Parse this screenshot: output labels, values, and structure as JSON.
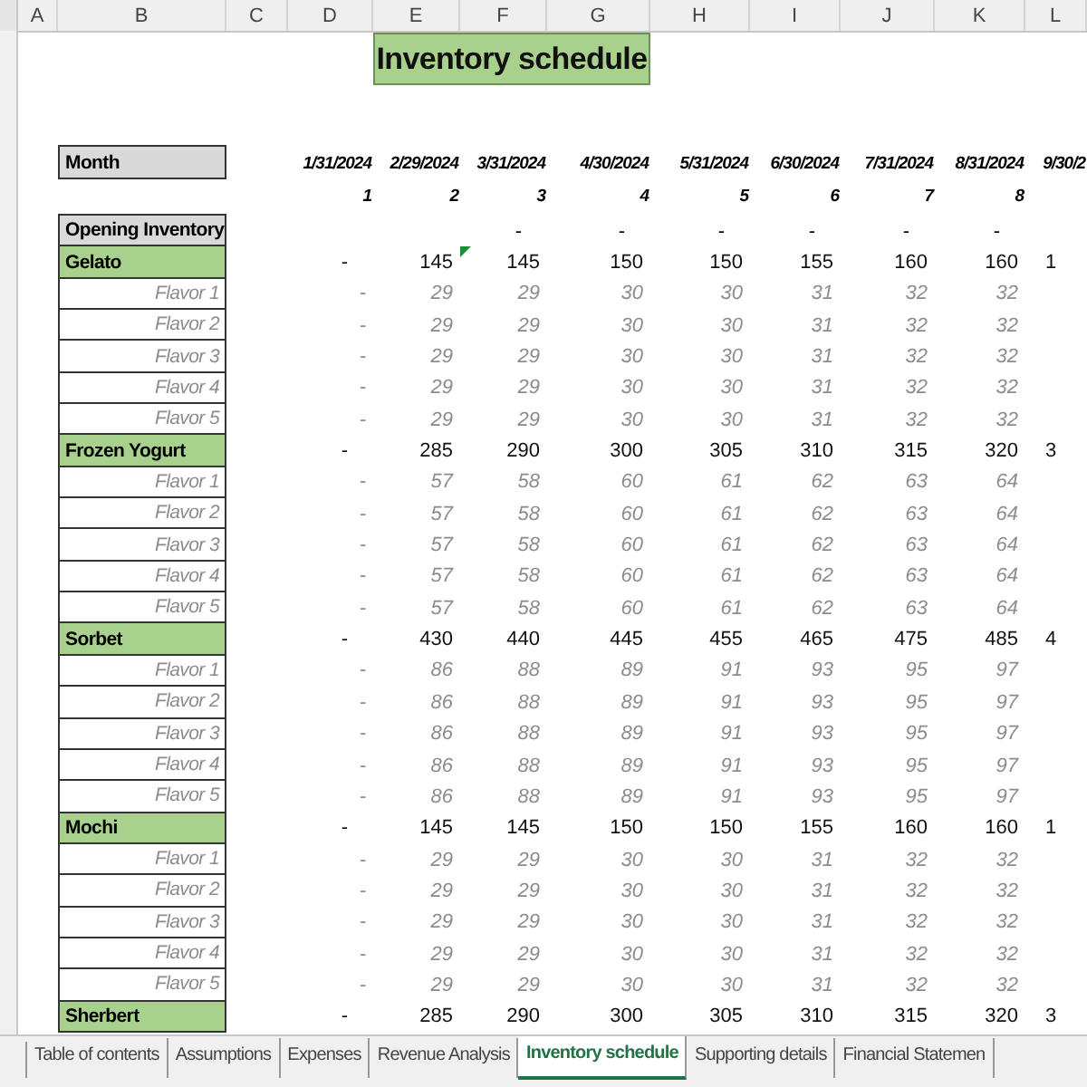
{
  "columns": [
    "A",
    "B",
    "C",
    "D",
    "E",
    "F",
    "G",
    "H",
    "I",
    "J",
    "K",
    "L"
  ],
  "title": "Inventory schedule",
  "month_label": "Month",
  "dates": [
    "1/31/2024",
    "2/29/2024",
    "3/31/2024",
    "4/30/2024",
    "5/31/2024",
    "6/30/2024",
    "7/31/2024",
    "8/31/2024",
    "9/30/2"
  ],
  "periods": [
    "1",
    "2",
    "3",
    "4",
    "5",
    "6",
    "7",
    "8"
  ],
  "opening": {
    "label": "Opening Inventory",
    "values": [
      "-",
      "-",
      "-",
      "-",
      "-",
      "-"
    ]
  },
  "groups": [
    {
      "name": "Gelato",
      "totals": [
        "-",
        "145",
        "145",
        "150",
        "150",
        "155",
        "160",
        "160",
        "1"
      ],
      "flavors": [
        {
          "name": "Flavor 1",
          "values": [
            "-",
            "29",
            "29",
            "30",
            "30",
            "31",
            "32",
            "32"
          ]
        },
        {
          "name": "Flavor 2",
          "values": [
            "-",
            "29",
            "29",
            "30",
            "30",
            "31",
            "32",
            "32"
          ]
        },
        {
          "name": "Flavor 3",
          "values": [
            "-",
            "29",
            "29",
            "30",
            "30",
            "31",
            "32",
            "32"
          ]
        },
        {
          "name": "Flavor 4",
          "values": [
            "-",
            "29",
            "29",
            "30",
            "30",
            "31",
            "32",
            "32"
          ]
        },
        {
          "name": "Flavor 5",
          "values": [
            "-",
            "29",
            "29",
            "30",
            "30",
            "31",
            "32",
            "32"
          ]
        }
      ]
    },
    {
      "name": "Frozen Yogurt",
      "totals": [
        "-",
        "285",
        "290",
        "300",
        "305",
        "310",
        "315",
        "320",
        "3"
      ],
      "flavors": [
        {
          "name": "Flavor 1",
          "values": [
            "-",
            "57",
            "58",
            "60",
            "61",
            "62",
            "63",
            "64"
          ]
        },
        {
          "name": "Flavor 2",
          "values": [
            "-",
            "57",
            "58",
            "60",
            "61",
            "62",
            "63",
            "64"
          ]
        },
        {
          "name": "Flavor 3",
          "values": [
            "-",
            "57",
            "58",
            "60",
            "61",
            "62",
            "63",
            "64"
          ]
        },
        {
          "name": "Flavor 4",
          "values": [
            "-",
            "57",
            "58",
            "60",
            "61",
            "62",
            "63",
            "64"
          ]
        },
        {
          "name": "Flavor 5",
          "values": [
            "-",
            "57",
            "58",
            "60",
            "61",
            "62",
            "63",
            "64"
          ]
        }
      ]
    },
    {
      "name": "Sorbet",
      "totals": [
        "-",
        "430",
        "440",
        "445",
        "455",
        "465",
        "475",
        "485",
        "4"
      ],
      "flavors": [
        {
          "name": "Flavor 1",
          "values": [
            "-",
            "86",
            "88",
            "89",
            "91",
            "93",
            "95",
            "97"
          ]
        },
        {
          "name": "Flavor 2",
          "values": [
            "-",
            "86",
            "88",
            "89",
            "91",
            "93",
            "95",
            "97"
          ]
        },
        {
          "name": "Flavor 3",
          "values": [
            "-",
            "86",
            "88",
            "89",
            "91",
            "93",
            "95",
            "97"
          ]
        },
        {
          "name": "Flavor 4",
          "values": [
            "-",
            "86",
            "88",
            "89",
            "91",
            "93",
            "95",
            "97"
          ]
        },
        {
          "name": "Flavor 5",
          "values": [
            "-",
            "86",
            "88",
            "89",
            "91",
            "93",
            "95",
            "97"
          ]
        }
      ]
    },
    {
      "name": "Mochi",
      "totals": [
        "-",
        "145",
        "145",
        "150",
        "150",
        "155",
        "160",
        "160",
        "1"
      ],
      "flavors": [
        {
          "name": "Flavor 1",
          "values": [
            "-",
            "29",
            "29",
            "30",
            "30",
            "31",
            "32",
            "32"
          ]
        },
        {
          "name": "Flavor 2",
          "values": [
            "-",
            "29",
            "29",
            "30",
            "30",
            "31",
            "32",
            "32"
          ]
        },
        {
          "name": "Flavor 3",
          "values": [
            "-",
            "29",
            "29",
            "30",
            "30",
            "31",
            "32",
            "32"
          ]
        },
        {
          "name": "Flavor 4",
          "values": [
            "-",
            "29",
            "29",
            "30",
            "30",
            "31",
            "32",
            "32"
          ]
        },
        {
          "name": "Flavor 5",
          "values": [
            "-",
            "29",
            "29",
            "30",
            "30",
            "31",
            "32",
            "32"
          ]
        }
      ]
    },
    {
      "name": "Sherbert",
      "totals": [
        "-",
        "285",
        "290",
        "300",
        "305",
        "310",
        "315",
        "320",
        "3"
      ]
    }
  ],
  "tabs": [
    {
      "label": "Table of contents",
      "selected": false
    },
    {
      "label": "Assumptions",
      "selected": false
    },
    {
      "label": "Expenses",
      "selected": false
    },
    {
      "label": "Revenue Analysis",
      "selected": false
    },
    {
      "label": "Inventory schedule",
      "selected": true
    },
    {
      "label": "Supporting details",
      "selected": false
    },
    {
      "label": "Financial Statemen",
      "selected": false
    }
  ]
}
